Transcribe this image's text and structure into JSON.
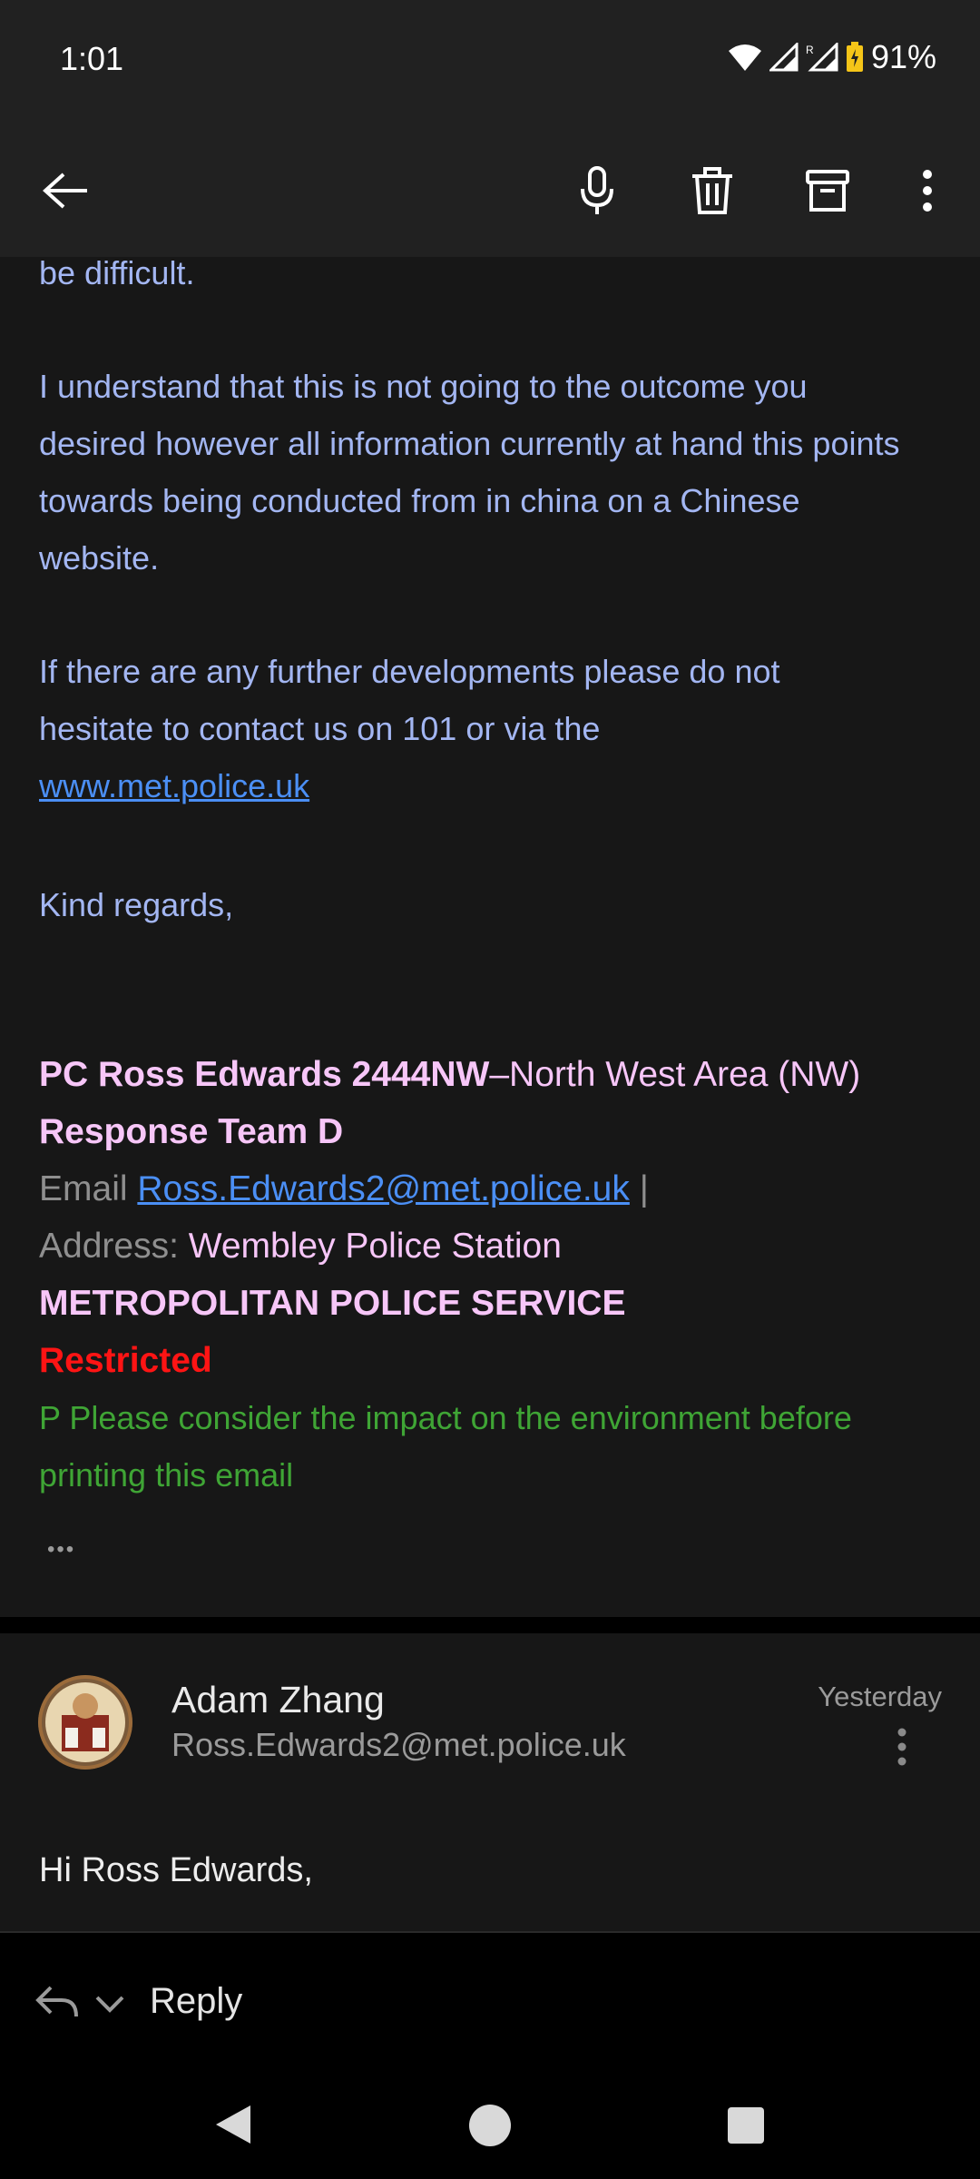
{
  "status_bar": {
    "time": "1:01",
    "battery": "91%"
  },
  "toolbar": {
    "back_icon": "arrow-left-icon",
    "mic_icon": "microphone-icon",
    "delete_icon": "trash-icon",
    "archive_icon": "archive-icon",
    "more_icon": "more-vertical-icon"
  },
  "message1": {
    "fragment": "be difficult.",
    "paragraph1": "I understand that this is not going to the outcome you desired however all information currently at hand this points towards being conducted from in china on a Chinese website.",
    "paragraph2": "If there are any further developments please do not hesitate to contact us on 101 or via the",
    "link": "www.met.police.uk",
    "closing": "Kind regards,",
    "signature": {
      "name": "PC Ross Edwards 2444NW",
      "dash": "–",
      "area": "North West Area (NW)",
      "team": "Response Team D",
      "email_label": "Email",
      "email": "Ross.Edwards2@met.police.uk",
      "email_sep": "|",
      "address_label": "Address:",
      "address": "Wembley Police Station",
      "org": "METROPOLITAN POLICE SERVICE",
      "restricted": "Restricted",
      "env_note": "P Please consider the impact on the environment before printing this email"
    },
    "ellipsis": "•••"
  },
  "message2": {
    "sender": "Adam Zhang",
    "email": "Ross.Edwards2@met.police.uk",
    "date": "Yesterday",
    "greeting": "Hi Ross Edwards,"
  },
  "reply_bar": {
    "label": "Reply"
  },
  "colors": {
    "body_text": "#a3b6f2",
    "link": "#4b8ff5",
    "signature": "#f7c6f8",
    "restricted": "#ff1414",
    "green": "#3fa535"
  }
}
